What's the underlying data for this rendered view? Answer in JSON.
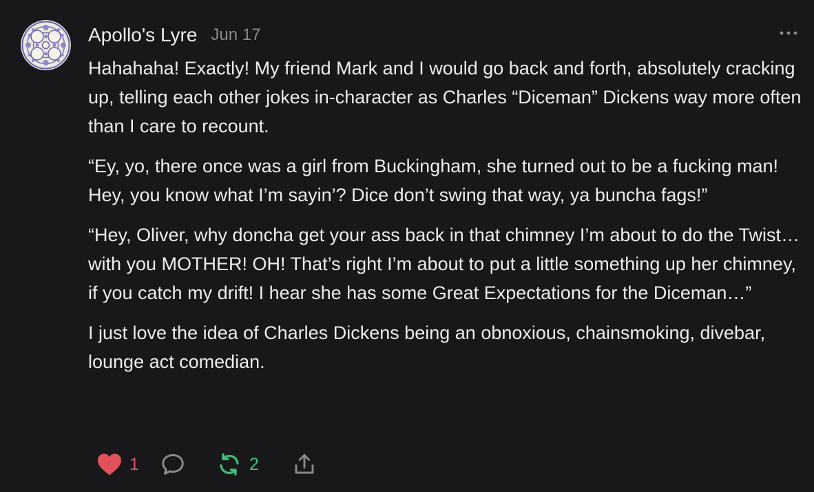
{
  "comment": {
    "author": "Apollo's Lyre",
    "date": "Jun 17",
    "paragraphs": [
      "Hahahaha! Exactly! My friend Mark and I would go back and forth, absolutely cracking up, telling each other jokes in-character as Charles “Diceman” Dickens way more often than I care to recount.",
      "“Ey, yo, there once was a girl from Buckingham, she turned out to be a fucking man! Hey, you know what I’m sayin’? Dice don’t swing that way, ya buncha fags!”",
      "“Hey, Oliver, why doncha get your ass back in that chimney I’m about to do the Twist… with you MOTHER! OH! That’s right I’m about to put a little something up her chimney, if you catch my drift! I hear she has some Great Expectations for the Diceman…”",
      "I just love the idea of Charles Dickens being an obnoxious, chainsmoking, divebar, lounge act comedian."
    ]
  },
  "actions": {
    "like_count": "1",
    "restack_count": "2",
    "like_icon": "heart-icon",
    "reply_icon": "speech-bubble-icon",
    "restack_icon": "restack-arrows-icon",
    "share_icon": "share-icon",
    "more_icon": "ellipsis-icon"
  },
  "colors": {
    "background": "#18181a",
    "text": "#ececec",
    "muted": "#8a8a8e",
    "like": "#e0535a",
    "restack": "#3cbf7a"
  }
}
